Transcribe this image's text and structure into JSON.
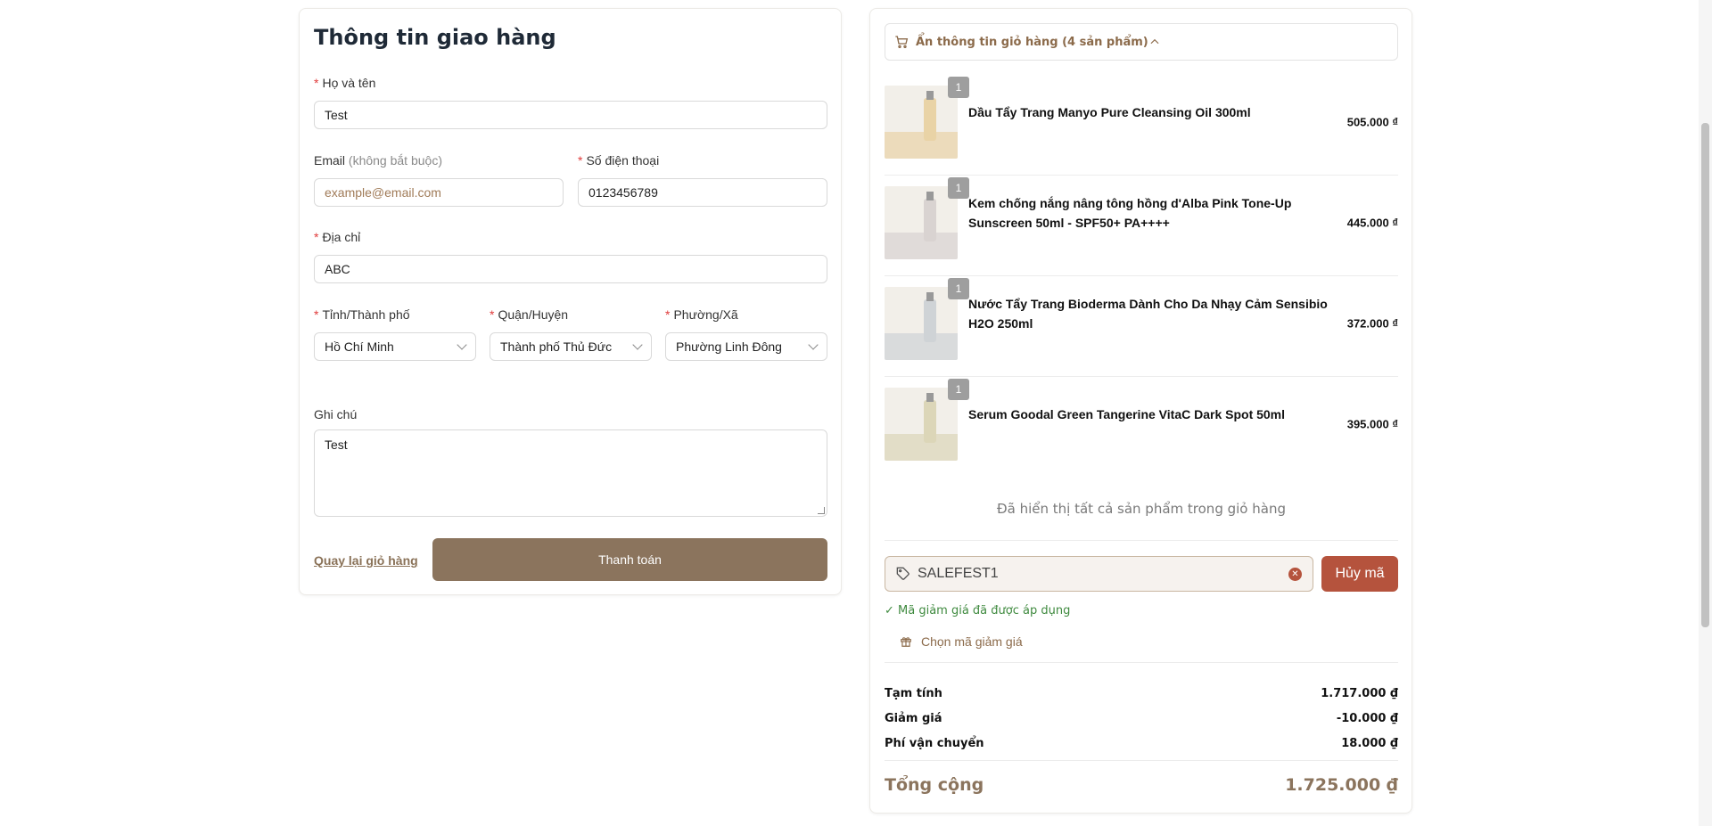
{
  "form": {
    "title": "Thông tin giao hàng",
    "fullname": {
      "label": "Họ và tên",
      "value": "Test"
    },
    "email": {
      "label": "Email",
      "hint": "(không bắt buộc)",
      "placeholder": "example@email.com"
    },
    "phone": {
      "label": "Số điện thoại",
      "value": "0123456789"
    },
    "address": {
      "label": "Địa chỉ",
      "value": "ABC"
    },
    "province": {
      "label": "Tỉnh/Thành phố",
      "value": "Hồ Chí Minh"
    },
    "district": {
      "label": "Quận/Huyện",
      "value": "Thành phố Thủ Đức"
    },
    "ward": {
      "label": "Phường/Xã",
      "value": "Phường Linh Đông"
    },
    "note": {
      "label": "Ghi chú",
      "value": "Test"
    },
    "back_label": "Quay lại giỏ hàng",
    "pay_label": "Thanh toán",
    "required_mark": "*"
  },
  "cart": {
    "toggle_label": "Ẩn thông tin giỏ hàng (4 sản phẩm)",
    "items": [
      {
        "qty": "1",
        "name": "Dầu Tẩy Trang Manyo Pure Cleansing Oil 300ml",
        "price": "505.000 ₫",
        "thumb_color": "#e9d3a6"
      },
      {
        "qty": "1",
        "name": "Kem chống nắng nâng tông hồng d'Alba Pink Tone-Up Sunscreen 50ml - SPF50+ PA++++",
        "price": "445.000 ₫",
        "thumb_color": "#d9d3d1"
      },
      {
        "qty": "1",
        "name": "Nước Tẩy Trang Bioderma Dành Cho Da Nhạy Cảm Sensibio H2O 250ml",
        "price": "372.000 ₫",
        "thumb_color": "#cfd3d6"
      },
      {
        "qty": "1",
        "name": "Serum Goodal Green Tangerine VitaC Dark Spot 50ml",
        "price": "395.000 ₫",
        "thumb_color": "#dcd6b8"
      }
    ],
    "all_shown_text": "Đã hiển thị tất cả sản phẩm trong giỏ hàng"
  },
  "coupon": {
    "code": "SALEFEST1",
    "cancel_label": "Hủy mã",
    "applied_message": "✓ Mã giảm giá đã được áp dụng",
    "choose_label": "Chọn mã giảm giá"
  },
  "summary": {
    "subtotal_label": "Tạm tính",
    "subtotal_value": "1.717.000 ₫",
    "discount_label": "Giảm giá",
    "discount_value": "-10.000 ₫",
    "shipping_label": "Phí vận chuyển",
    "shipping_value": "18.000 ₫",
    "total_label": "Tổng cộng",
    "total_value": "1.725.000 ₫"
  },
  "colors": {
    "accent": "#8b745d",
    "danger": "#b5533d",
    "success": "#3f8a3f",
    "required": "#e03b3b"
  }
}
